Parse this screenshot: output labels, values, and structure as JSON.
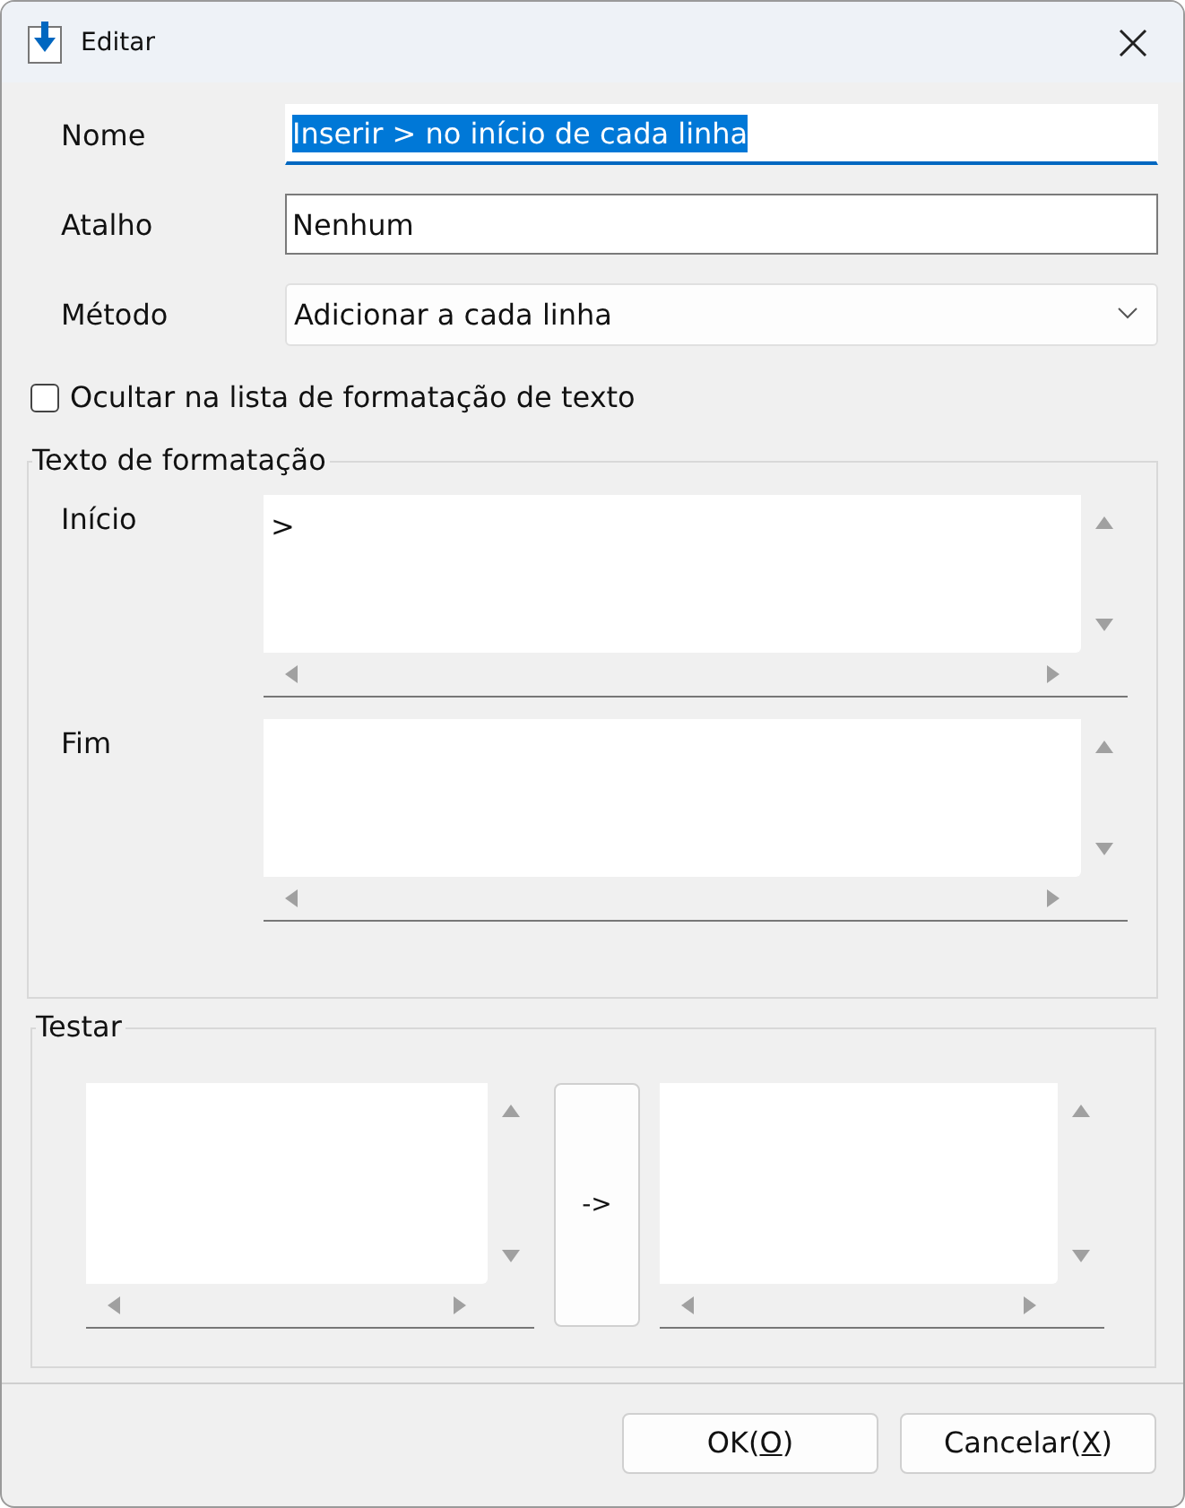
{
  "window": {
    "title": "Editar"
  },
  "fields": [
    {
      "kind": "text",
      "label": "Nome",
      "value": "Inserir > no início de cada linha",
      "focused": true,
      "text_selected": true
    },
    {
      "kind": "text",
      "label": "Atalho",
      "value": "Nenhum",
      "focused": false,
      "text_selected": false
    },
    {
      "kind": "dropdown",
      "label": "Método",
      "value": "Adicionar a cada linha"
    }
  ],
  "hide_checkbox": {
    "label": "Ocultar na lista de formatação de texto",
    "checked": false
  },
  "format_group": {
    "title": "Texto de formatação",
    "areas": [
      {
        "label": "Início",
        "value": ">"
      },
      {
        "label": "Fim"
      }
    ]
  },
  "test_group": {
    "title": "Testar",
    "run_button": "->"
  },
  "buttons": [
    {
      "before": "OK(",
      "accesskey": "O",
      "after": ")"
    },
    {
      "before": "Cancelar(",
      "accesskey": "X",
      "after": ")"
    }
  ]
}
